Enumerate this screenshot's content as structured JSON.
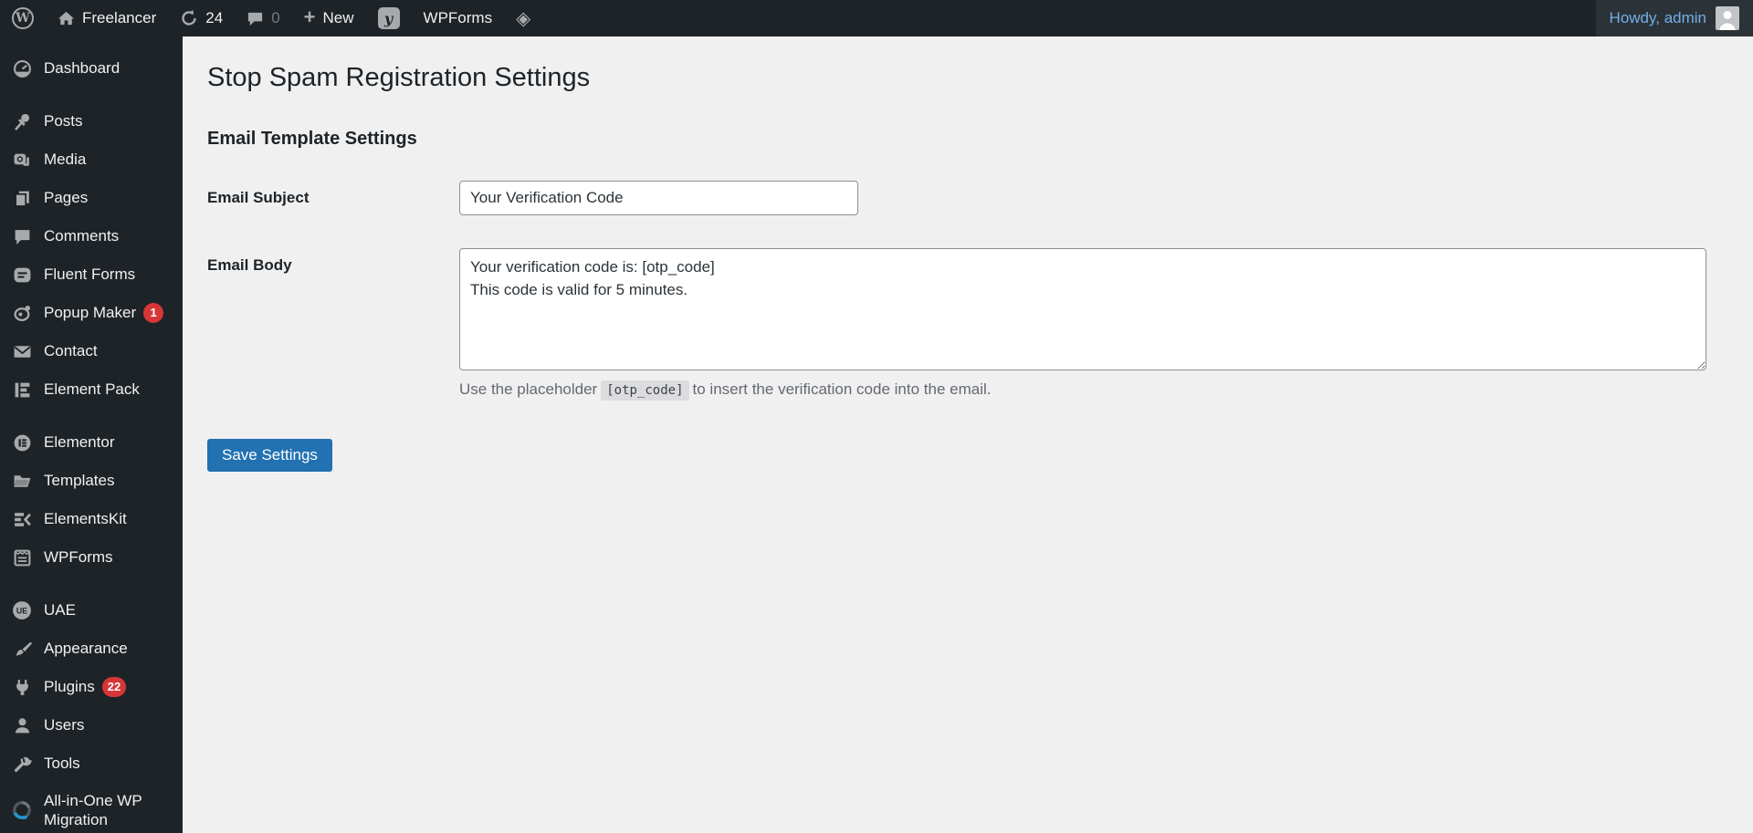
{
  "admin_bar": {
    "site_name": "Freelancer",
    "updates_count": "24",
    "comments_count": "0",
    "new_label": "New",
    "wpforms_label": "WPForms",
    "howdy_label": "Howdy, admin"
  },
  "sidebar": {
    "items": [
      {
        "label": "Dashboard"
      },
      {
        "label": "Posts"
      },
      {
        "label": "Media"
      },
      {
        "label": "Pages"
      },
      {
        "label": "Comments"
      },
      {
        "label": "Fluent Forms"
      },
      {
        "label": "Popup Maker",
        "badge": "1"
      },
      {
        "label": "Contact"
      },
      {
        "label": "Element Pack"
      },
      {
        "label": "Elementor"
      },
      {
        "label": "Templates"
      },
      {
        "label": "ElementsKit"
      },
      {
        "label": "WPForms"
      },
      {
        "label": "UAE"
      },
      {
        "label": "Appearance"
      },
      {
        "label": "Plugins",
        "badge": "22"
      },
      {
        "label": "Users"
      },
      {
        "label": "Tools"
      },
      {
        "label": "All-in-One WP Migration"
      }
    ]
  },
  "main": {
    "page_title": "Stop Spam Registration Settings",
    "section_title": "Email Template Settings",
    "form": {
      "email_subject_label": "Email Subject",
      "email_subject_value": "Your Verification Code",
      "email_body_label": "Email Body",
      "email_body_value": "Your verification code is: [otp_code]\nThis code is valid for 5 minutes.",
      "helper_prefix": "Use the placeholder",
      "helper_code": "[otp_code]",
      "helper_suffix": "to insert the verification code into the email.",
      "save_label": "Save Settings"
    }
  },
  "colors": {
    "admin_bar_bg": "#1d2327",
    "sidebar_bg": "#1d2327",
    "content_bg": "#f0f0f1",
    "accent_blue": "#2271b1",
    "badge_red": "#d63638",
    "link_blue": "#72aee6"
  }
}
